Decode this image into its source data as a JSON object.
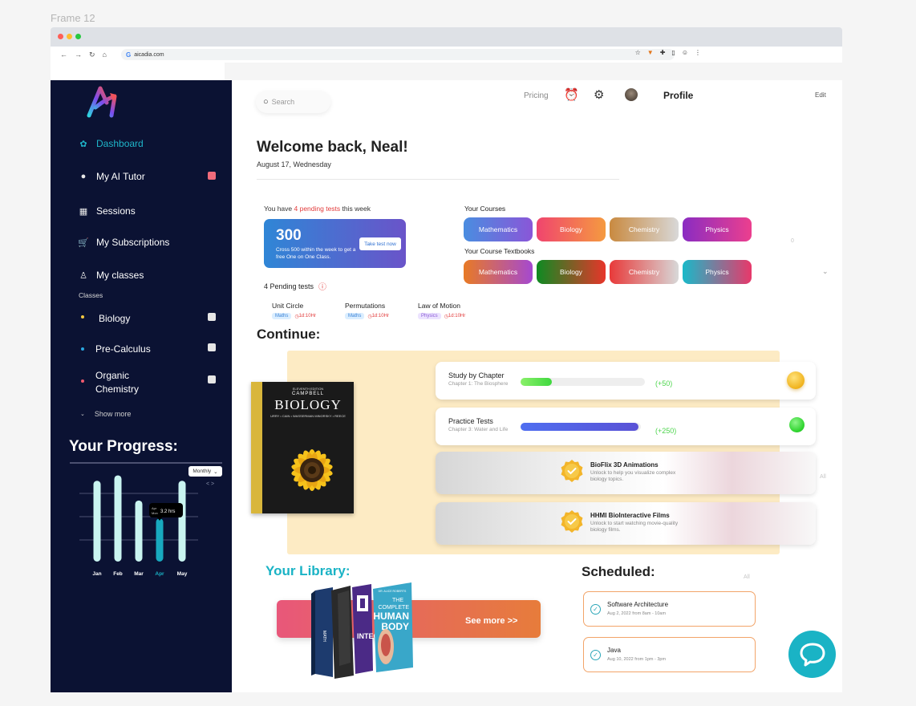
{
  "frame_label": "Frame 12",
  "browser": {
    "url": "aicadia.com"
  },
  "sidebar": {
    "nav": [
      {
        "label": "Dashboard",
        "icon": "dashboard-icon",
        "active": true
      },
      {
        "label": "My AI Tutor",
        "icon": "chat-bubble-icon"
      },
      {
        "label": "Sessions",
        "icon": "calendar-icon"
      },
      {
        "label": "My Subscriptions",
        "icon": "cart-icon"
      },
      {
        "label": "My classes",
        "icon": "person-icon"
      }
    ],
    "classes_title": "Classes",
    "classes": [
      {
        "label": "Biology",
        "dot": "#f5c842"
      },
      {
        "label": "Pre-Calculus",
        "dot": "#2aa6e0"
      },
      {
        "label": "Organic Chemistry",
        "dot": "#f05a6e"
      }
    ],
    "show_more": "Show more",
    "progress": {
      "title": "Your Progress:",
      "period": "Monthly",
      "tooltip_month": "Apr",
      "tooltip_month_2": "Mon",
      "tooltip_value": "3.2 hrs"
    }
  },
  "chart_data": {
    "type": "bar",
    "categories": [
      "Jan",
      "Feb",
      "Mar",
      "Apr",
      "May"
    ],
    "values": [
      0.9,
      0.96,
      0.68,
      0.48,
      0.9
    ],
    "highlight": "Apr",
    "annotation": "3.2 hrs"
  },
  "header": {
    "search_placeholder": "Search",
    "pricing": "Pricing",
    "profile": "Profile",
    "edit": "Edit"
  },
  "welcome": {
    "title": "Welcome back, Neal!",
    "date": "August 17, Wednesday"
  },
  "pending": {
    "text_before": "You have ",
    "highlight": "4 pending tests",
    "text_after": " this week",
    "score": "300",
    "score_desc": "Cross 500 within the week to get a free One on One Class.",
    "take_test": "Take test now",
    "tests_title": "4 Pending tests",
    "tests": [
      {
        "name": "Unit Circle",
        "tag": "Maths",
        "time": "1d:10Hr",
        "tag_bg": "#dbeeff",
        "tag_color": "#3a82d6"
      },
      {
        "name": "Permutations",
        "tag": "Maths",
        "time": "1d:10Hr",
        "tag_bg": "#dbeeff",
        "tag_color": "#3a82d6"
      },
      {
        "name": "Law of Motion",
        "tag": "Physics",
        "time": "1d:10Hr",
        "tag_bg": "#ece3ff",
        "tag_color": "#8b5cd6"
      }
    ]
  },
  "courses": {
    "title": "Your Courses",
    "items": [
      "Mathematics",
      "Biology",
      "Chemistry",
      "Physics"
    ],
    "textbooks_title": "Your Course Textbooks",
    "textbooks": [
      "Mathematics",
      "Biology",
      "Chemistry",
      "Physics"
    ],
    "side_mark": "0"
  },
  "continue": {
    "title": "Continue:",
    "book": {
      "edition": "ELEVENTH EDITION",
      "publisher": "CAMPBELL",
      "title": "BIOLOGY",
      "authors": "URRY • CAIN • WASSERMAN MINORSKY • REECE"
    },
    "cards": [
      {
        "title": "Study by Chapter",
        "sub": "Chapter 1: The Biosphere",
        "progress": 0.25,
        "points": "(+50)",
        "color": "#4cd54c"
      },
      {
        "title": "Practice Tests",
        "sub": "Chapter 3: Water and Life",
        "progress": 0.98,
        "points": "(+250)",
        "color": "#4c5de8"
      }
    ],
    "media": [
      {
        "title": "BioFlix 3D Animations",
        "sub": "Unlock to help you visualize complex biology topics."
      },
      {
        "title": "HHMI BioInteractive Films",
        "sub": "Unlock to start watching movie-quality biology films."
      }
    ],
    "side_all": "All"
  },
  "library": {
    "title": "Your Library:",
    "see_more": "See more >>",
    "book_cover": {
      "author": "DR. ALICE ROBERTS",
      "line1": "THE",
      "line2": "COMPLETE",
      "line3": "HUMAN",
      "line4": "BODY"
    }
  },
  "scheduled": {
    "title": "Scheduled:",
    "all": "All",
    "items": [
      {
        "title": "Software Architecture",
        "sub": "Aug 2, 2022 from 8am - 10am"
      },
      {
        "title": "Java",
        "sub": "Aug 10, 2022 from 1pm - 3pm"
      }
    ]
  }
}
